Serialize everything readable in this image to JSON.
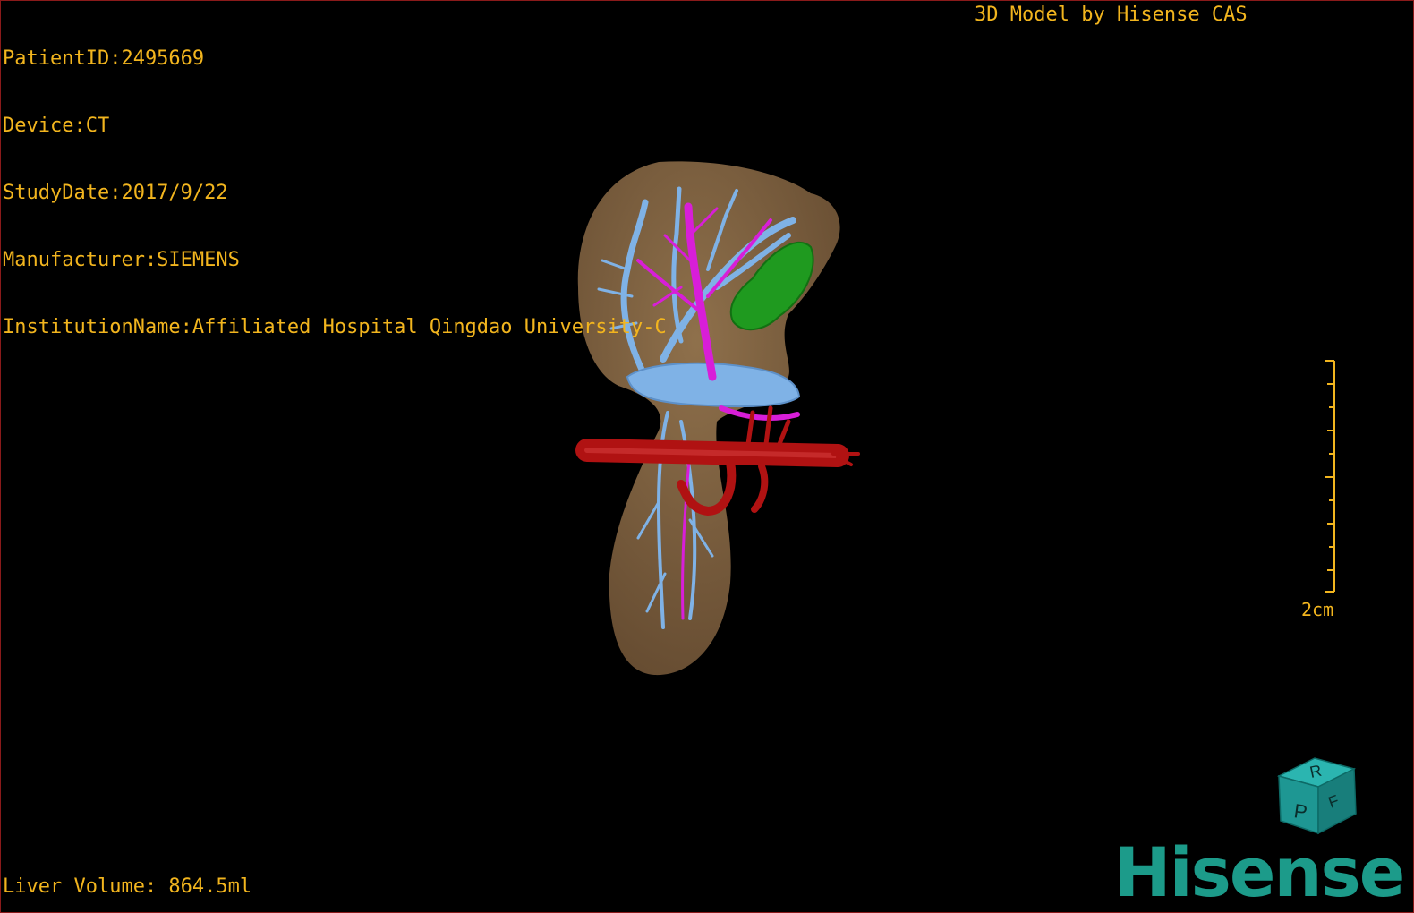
{
  "patient_info": {
    "patient_id": "PatientID:2495669",
    "device": "Device:CT",
    "study_date": "StudyDate:2017/9/22",
    "manufacturer": "Manufacturer:SIEMENS",
    "institution": "InstitutionName:Affiliated Hospital Qingdao University-C"
  },
  "model_credit": "3D Model by Hisense CAS",
  "liver_volume": "Liver Volume: 864.5ml",
  "scale_bar": {
    "label": "2cm"
  },
  "orientation_cube": {
    "top_label": "R",
    "front_label": "P",
    "side_label": "F"
  },
  "brand": {
    "logo_text": "Hisense"
  },
  "colors": {
    "overlay_text": "#f2b51e",
    "liver": "#8a6a45",
    "hepatic_vein": "#7fb2e6",
    "portal_vein": "#d81ed8",
    "artery": "#b01212",
    "tumor": "#1f9a1f",
    "brand": "#1c9b8a"
  }
}
